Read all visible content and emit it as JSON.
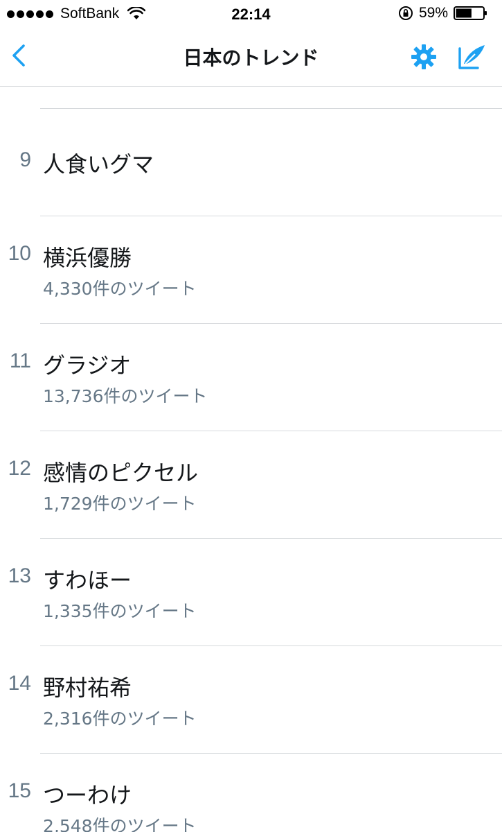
{
  "status_bar": {
    "carrier": "SoftBank",
    "time": "22:14",
    "battery": "59%",
    "battery_level": 0.59
  },
  "nav": {
    "title": "日本のトレンド"
  },
  "icons": {
    "back": "chevron-left-icon",
    "settings": "gear-icon",
    "compose": "compose-icon"
  },
  "colors": {
    "accent": "#1da1f2",
    "secondary_text": "#657786",
    "divider": "#d6d9dc"
  },
  "trends": [
    {
      "rank": "9",
      "name": "人食いグマ",
      "count": ""
    },
    {
      "rank": "10",
      "name": "横浜優勝",
      "count": "4,330件のツイート"
    },
    {
      "rank": "11",
      "name": "グラジオ",
      "count": "13,736件のツイート"
    },
    {
      "rank": "12",
      "name": "感情のピクセル",
      "count": "1,729件のツイート"
    },
    {
      "rank": "13",
      "name": "すわほー",
      "count": "1,335件のツイート"
    },
    {
      "rank": "14",
      "name": "野村祐希",
      "count": "2,316件のツイート"
    },
    {
      "rank": "15",
      "name": "つーわけ",
      "count": "2,548件のツイート"
    }
  ]
}
